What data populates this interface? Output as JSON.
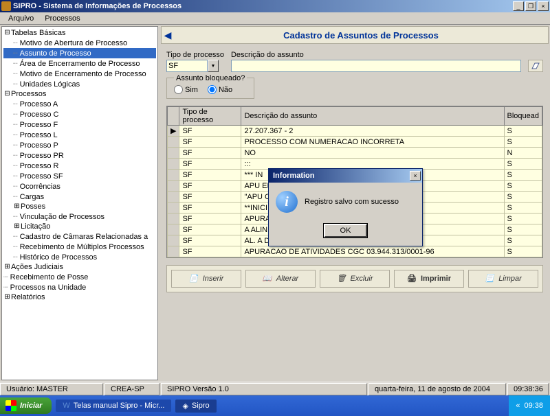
{
  "window": {
    "title": "SIPRO - Sistema de Informações de Processos",
    "min": "_",
    "max": "❐",
    "close": "×"
  },
  "menu": {
    "arquivo": "Arquivo",
    "processos": "Processos"
  },
  "tree": {
    "n0": "Tabelas Básicas",
    "n0_0": "Motivo de Abertura de Processo",
    "n0_1": "Assunto de Processo",
    "n0_2": "Área de Encerramento de Processo",
    "n0_3": "Motivo de Encerramento de Processo",
    "n0_4": "Unidades Lógicas",
    "n1": "Processos",
    "n1_0": "Processo A",
    "n1_1": "Processo C",
    "n1_2": "Processo F",
    "n1_3": "Processo L",
    "n1_4": "Processo P",
    "n1_5": "Processo PR",
    "n1_6": "Processo R",
    "n1_7": "Processo SF",
    "n1_8": "Ocorrências",
    "n1_9": "Cargas",
    "n1_10": "Posses",
    "n1_11": "Vinculação de Processos",
    "n1_12": "Licitação",
    "n1_13": "Cadastro de Câmaras Relacionadas a",
    "n1_14": "Recebimento de Múltiplos Processos",
    "n1_15": "Histórico de Processos",
    "n2": "Ações Judiciais",
    "n3": "Recebimento de Posse",
    "n4": "Processos na Unidade",
    "n5": "Relatórios"
  },
  "page": {
    "back": "◀",
    "title": "Cadastro de Assuntos de Processos",
    "tipo_label": "Tipo de processo",
    "tipo_value": "SF",
    "desc_label": "Descrição do assunto",
    "desc_value": "",
    "bloq_legend": "Assunto bloqueado?",
    "sim": "Sim",
    "nao": "Não"
  },
  "grid": {
    "h1": "Tipo de processo",
    "h2": "Descrição do assunto",
    "h3": "Bloquead",
    "rows": [
      {
        "t": "SF",
        "d": "27.207.367 - 2",
        "b": "S"
      },
      {
        "t": "SF",
        "d": "PROCESSO COM NUMERACAO INCORRETA",
        "b": "S"
      },
      {
        "t": "SF",
        "d": "NO",
        "b": "N"
      },
      {
        "t": "SF",
        "d": ":::",
        "b": "S"
      },
      {
        "t": "SF",
        "d": "*** IN",
        "b": "S"
      },
      {
        "t": "SF",
        "d": "APU                                              ENUNCIA",
        "b": "S"
      },
      {
        "t": "SF",
        "d": "\"APU                                              CAO DE",
        "b": "S"
      },
      {
        "t": "SF",
        "d": "**INICI                                              NHO**",
        "b": "S"
      },
      {
        "t": "SF",
        "d": "APURACAO DE ATIVIDADES",
        "b": "S"
      },
      {
        "t": "SF",
        "d": "A ALINEA \"A\" DO ARTIGO 6. DA LEI 5.194/66",
        "b": "S"
      },
      {
        "t": "SF",
        "d": "AL. A DO ART. 6 LEI 5194/66",
        "b": "S"
      },
      {
        "t": "SF",
        "d": "APURACAO DE ATIVIDADES  CGC 03.944.313/0001-96",
        "b": "S"
      }
    ]
  },
  "buttons": {
    "inserir": "Inserir",
    "alterar": "Alterar",
    "excluir": "Excluir",
    "imprimir": "Imprimir",
    "limpar": "Limpar"
  },
  "status": {
    "user": "Usuário: MASTER",
    "crea": "CREA-SP",
    "ver": "SIPRO Versão 1.0",
    "date": "quarta-feira, 11 de agosto de 2004",
    "time": "09:38:36"
  },
  "taskbar": {
    "start": "Iniciar",
    "t1": "Telas manual Sipro - Micr...",
    "t2": "Sipro",
    "clock": "09:38"
  },
  "modal": {
    "title": "Information",
    "msg": "Registro salvo com sucesso",
    "ok": "OK",
    "close": "×"
  }
}
